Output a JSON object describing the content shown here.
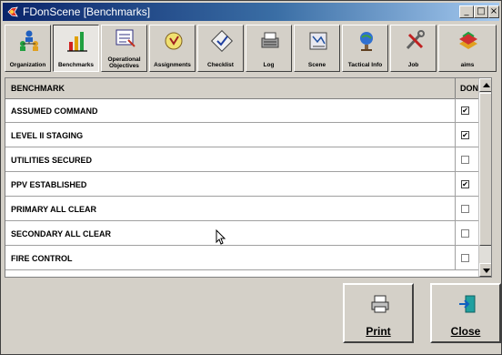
{
  "window": {
    "title": "FDonScene [Benchmarks]",
    "min_glyph": "_",
    "max_glyph": "□",
    "close_glyph": "×"
  },
  "toolbar": {
    "items": [
      {
        "label": "Organization",
        "icon": "organization-icon"
      },
      {
        "label": "Benchmarks",
        "icon": "benchmarks-icon",
        "active": true
      },
      {
        "label": "Operational Objectives",
        "icon": "objectives-icon"
      },
      {
        "label": "Assignments",
        "icon": "assignments-icon"
      },
      {
        "label": "Checklist",
        "icon": "checklist-icon"
      },
      {
        "label": "Log",
        "icon": "log-icon"
      },
      {
        "label": "Scene",
        "icon": "scene-icon"
      },
      {
        "label": "Tactical Info",
        "icon": "tactical-info-icon"
      },
      {
        "label": "Job",
        "icon": "job-icon"
      },
      {
        "label": "aims",
        "icon": "aims-icon"
      }
    ]
  },
  "table": {
    "headers": {
      "benchmark": "BENCHMARK",
      "done": "DONE"
    },
    "rows": [
      {
        "name": "ASSUMED COMMAND",
        "done": true
      },
      {
        "name": "LEVEL II STAGING",
        "done": true
      },
      {
        "name": "UTILITIES SECURED",
        "done": false
      },
      {
        "name": "PPV ESTABLISHED",
        "done": true
      },
      {
        "name": "PRIMARY ALL CLEAR",
        "done": false
      },
      {
        "name": "SECONDARY ALL CLEAR",
        "done": false
      },
      {
        "name": "FIRE CONTROL",
        "done": false
      }
    ]
  },
  "buttons": {
    "print": "Print",
    "close": "Close"
  },
  "colors": {
    "title_bar": "#0a246a",
    "face": "#d4d0c8"
  }
}
